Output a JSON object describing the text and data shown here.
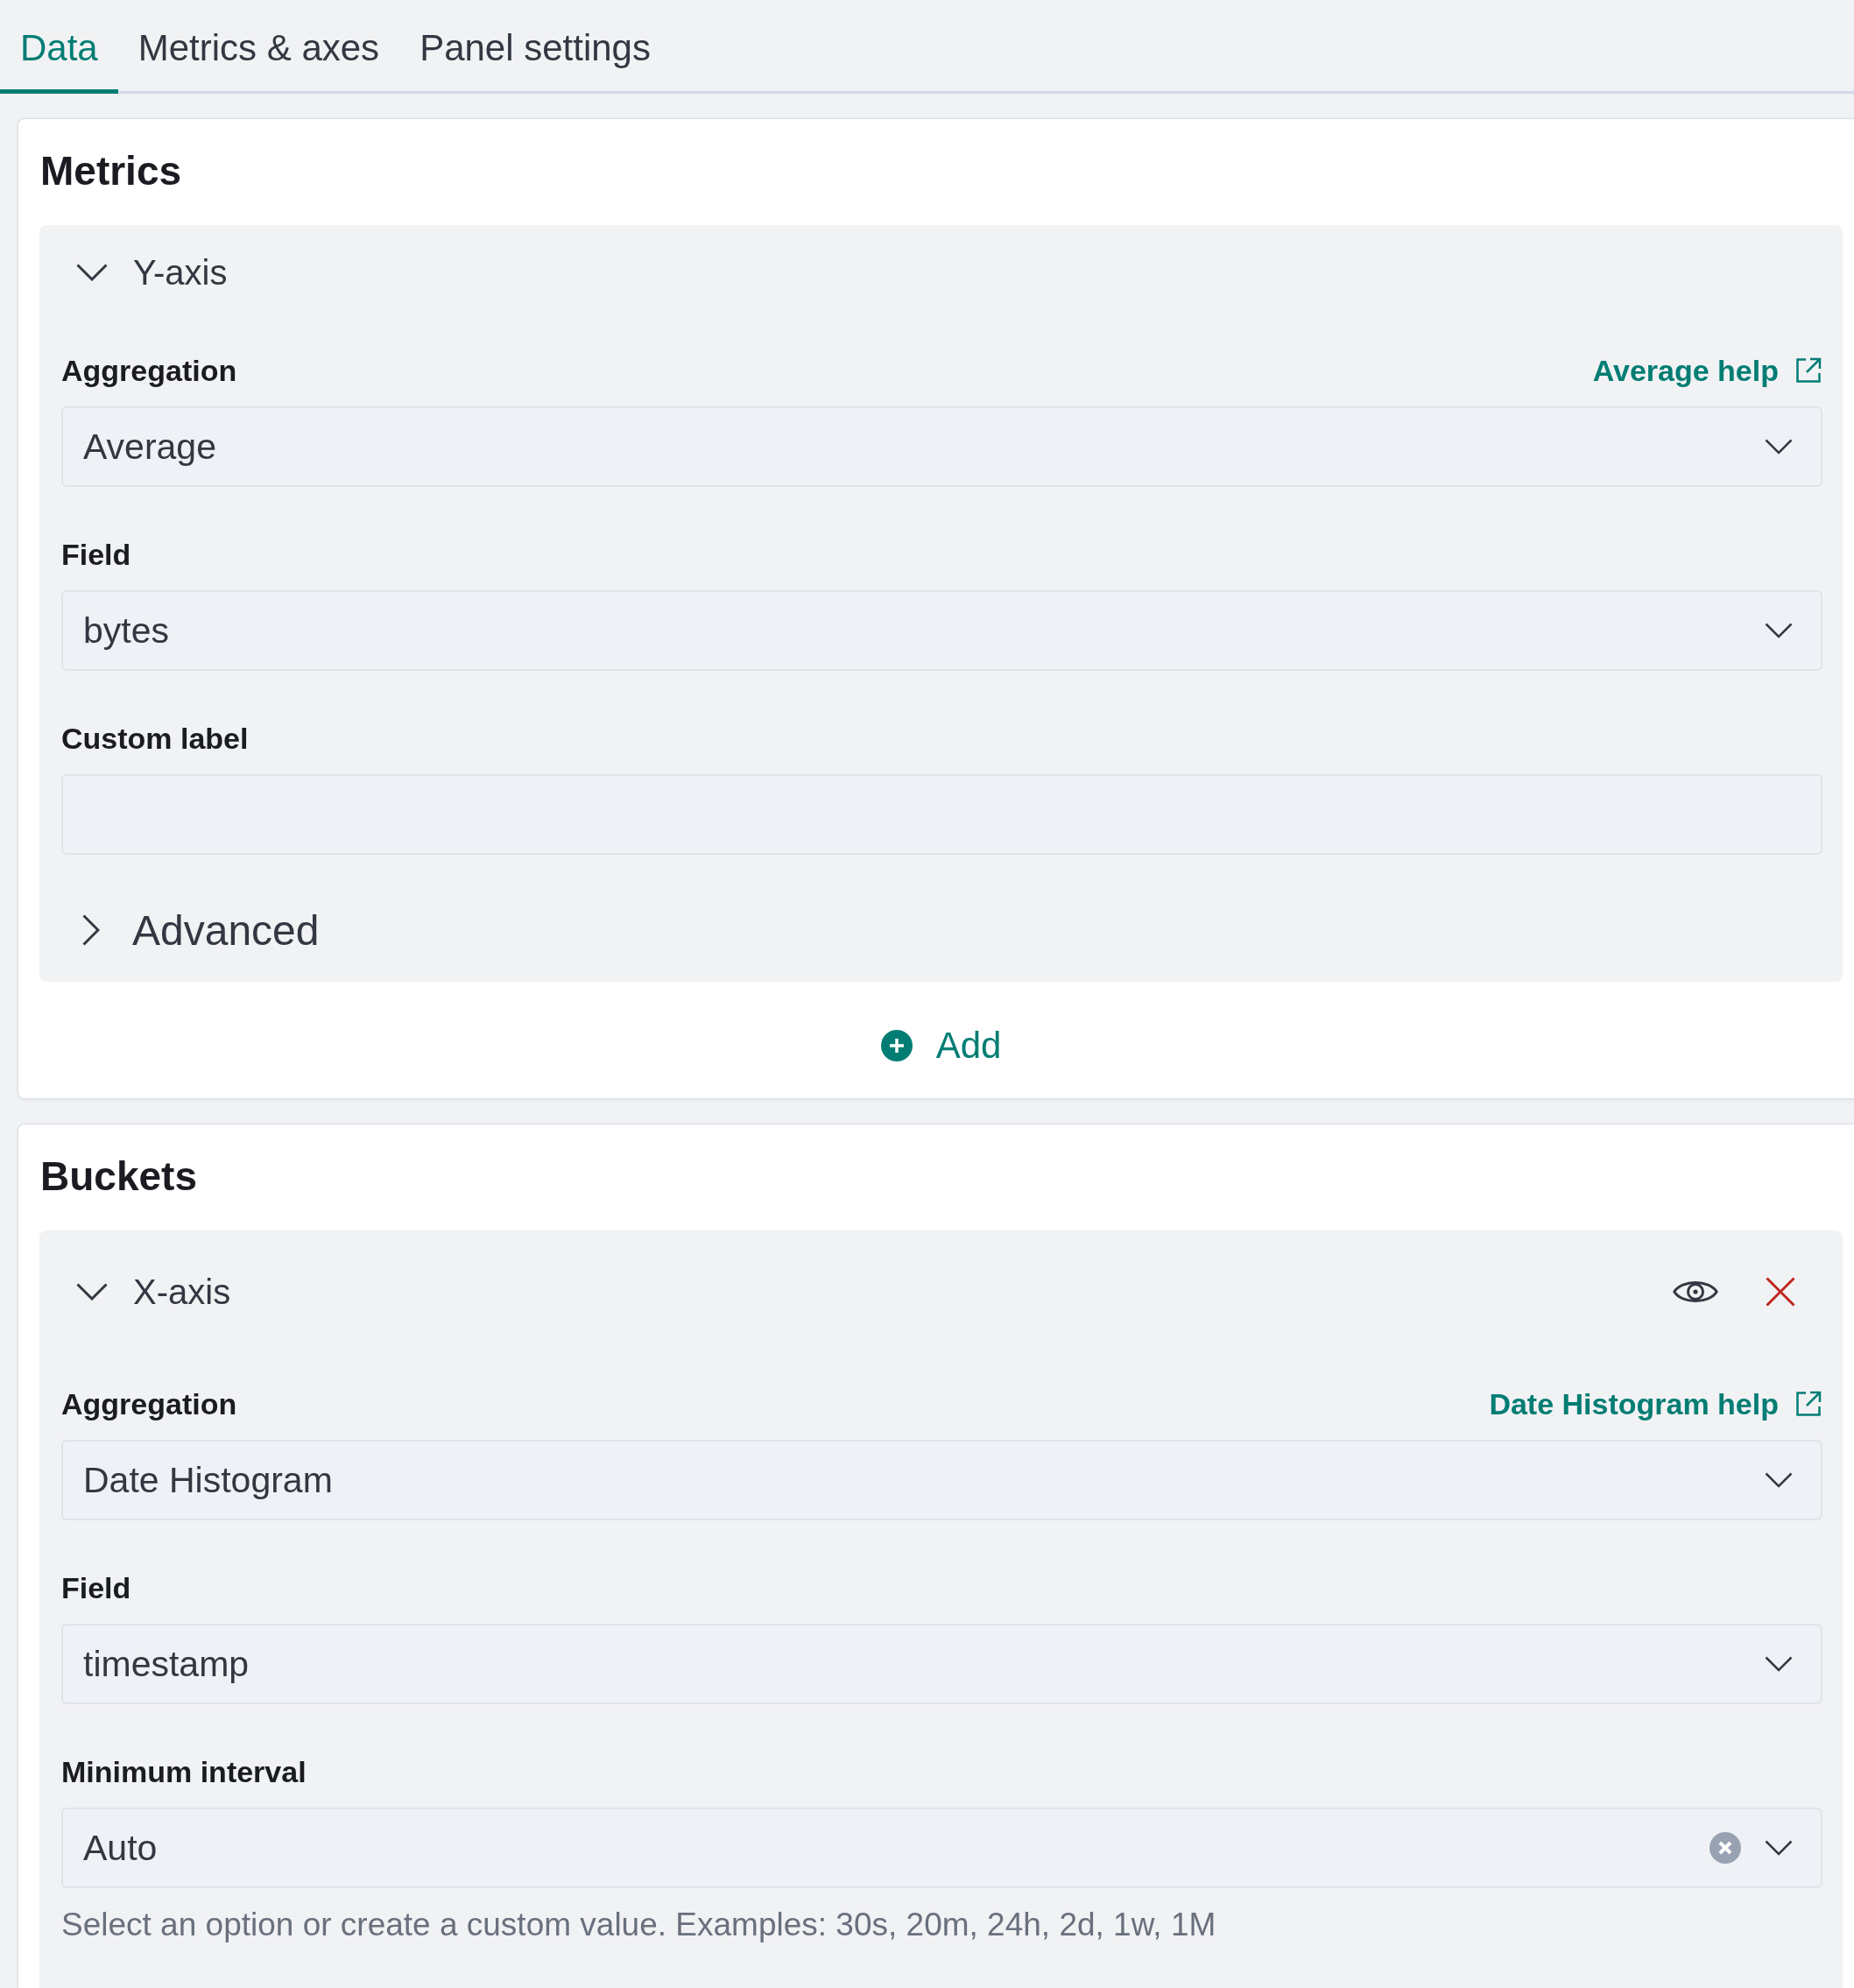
{
  "tabs": [
    {
      "label": "Data",
      "selected": true
    },
    {
      "label": "Metrics & axes",
      "selected": false
    },
    {
      "label": "Panel settings",
      "selected": false
    }
  ],
  "sections": [
    {
      "title": "Metrics",
      "items": [
        {
          "title": "Y-axis",
          "expanded": true,
          "removable": false,
          "fields": [
            {
              "kind": "select",
              "label": "Aggregation",
              "help_link": "Average help",
              "value": "Average",
              "clearable": false
            },
            {
              "kind": "select",
              "label": "Field",
              "value": "bytes",
              "clearable": false
            },
            {
              "kind": "text",
              "label": "Custom label"
            }
          ],
          "advanced": {
            "label": "Advanced",
            "expanded": false
          }
        }
      ],
      "add_button": "Add"
    },
    {
      "title": "Buckets",
      "items": [
        {
          "title": "X-axis",
          "expanded": true,
          "removable": true,
          "fields": [
            {
              "kind": "select",
              "label": "Aggregation",
              "help_link": "Date Histogram help",
              "value": "Date Histogram",
              "clearable": false
            },
            {
              "kind": "select",
              "label": "Field",
              "value": "timestamp",
              "clearable": false
            },
            {
              "kind": "select",
              "label": "Minimum interval",
              "value": "Auto",
              "clearable": true,
              "help_text": "Select an option or create a custom value. Examples: 30s, 20m, 24h, 2d, 1w, 1M"
            }
          ]
        }
      ]
    }
  ]
}
